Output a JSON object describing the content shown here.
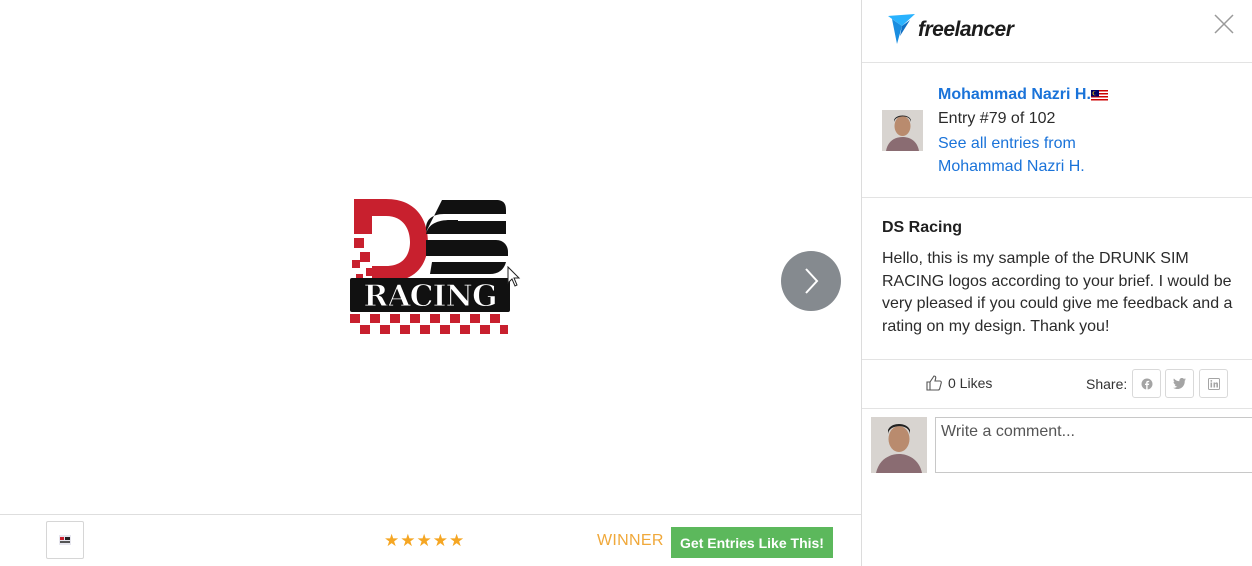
{
  "viewer": {
    "design_alt": "DS Racing logo entry",
    "design_text": {
      "monogram": "DS",
      "wordmark": "RACING"
    },
    "rating": {
      "stars": 5,
      "max": 5
    },
    "winner_label": "WINNER",
    "cta_label": "Get Entries Like This!"
  },
  "panel": {
    "brand": "freelancer",
    "author": {
      "name": "Mohammad Nazri H.",
      "flag": "malaysia-flag",
      "entry_text": "Entry #79 of 102",
      "see_all_line1": "See all entries from",
      "see_all_line2": "Mohammad Nazri H."
    },
    "description": {
      "title": "DS Racing",
      "body": "Hello, this is my sample of the DRUNK SIM RACING logos according to your brief. I would be very pleased if you could give me feedback and a rating on my design. Thank you!"
    },
    "likes": {
      "label": "0 Likes"
    },
    "share": {
      "label": "Share:",
      "networks": [
        "facebook-icon",
        "twitter-icon",
        "linkedin-icon"
      ]
    },
    "comment": {
      "placeholder": "Write a comment..."
    }
  },
  "colors": {
    "link": "#1a73d9",
    "star": "#f5a623",
    "winner": "#f0a83a",
    "cta": "#5cb85c",
    "logo_red": "#c8202e",
    "nav_button": "#858a8f"
  }
}
